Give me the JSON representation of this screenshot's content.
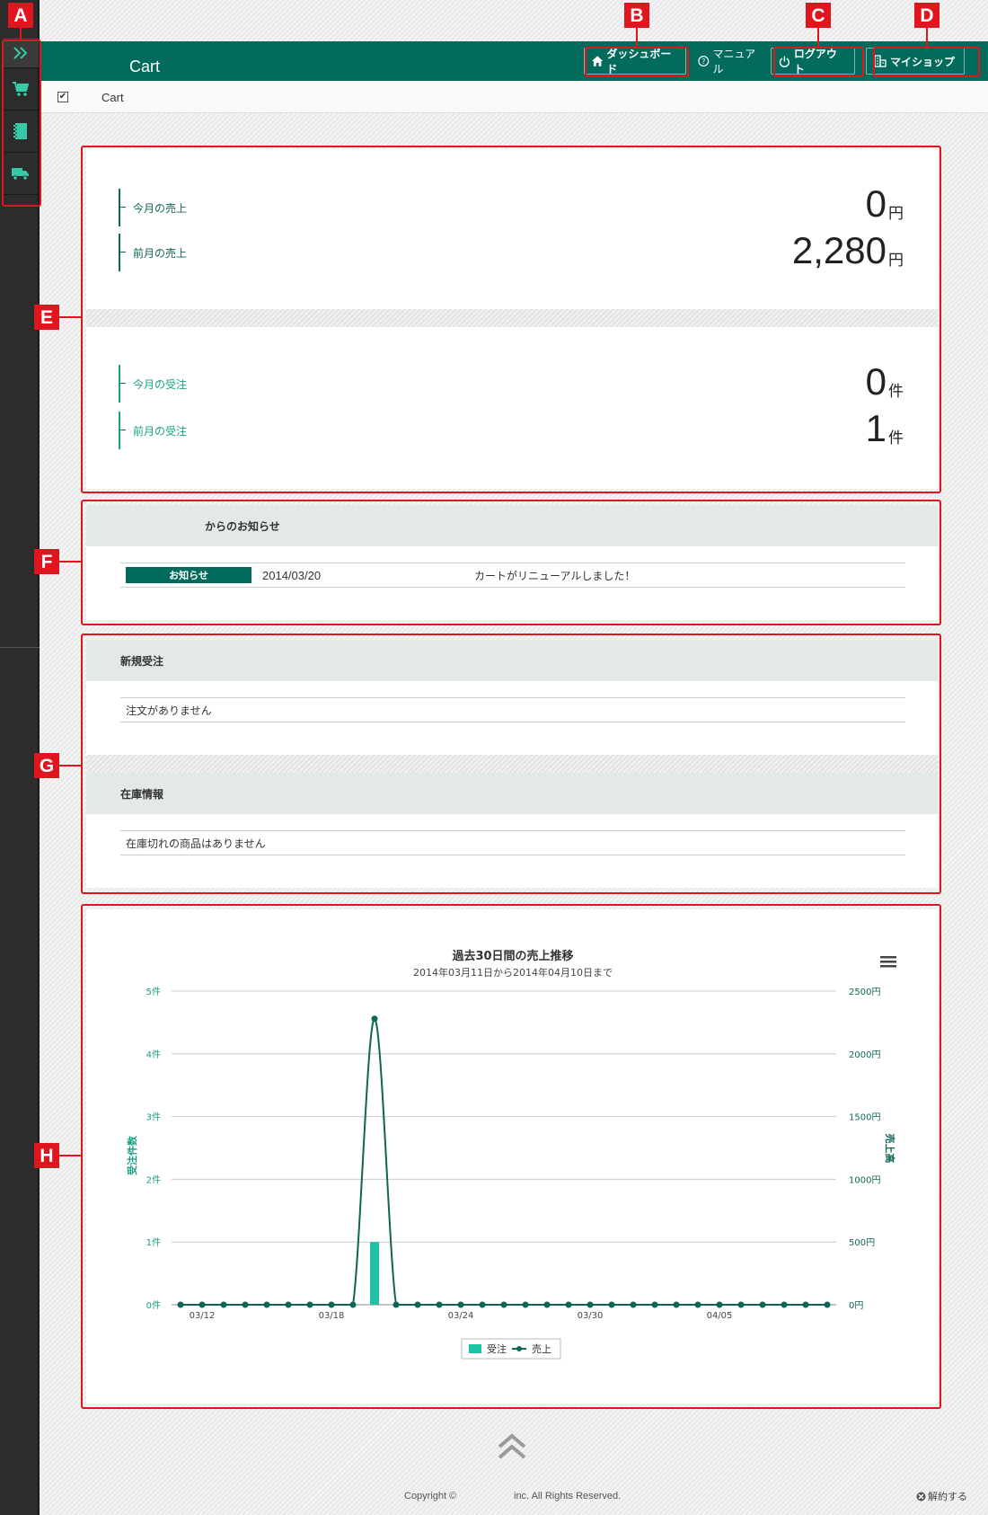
{
  "header": {
    "title": "Cart",
    "buttons": [
      {
        "label": "ダッシュボード",
        "icon": "home-icon"
      },
      {
        "label": "マニュアル",
        "icon": "help-icon"
      },
      {
        "label": "ログアウト",
        "icon": "power-icon"
      },
      {
        "label": "マイショップ",
        "icon": "shop-icon"
      }
    ]
  },
  "breadcrumb": {
    "label": "Cart"
  },
  "sidebar": {
    "items": [
      {
        "icon": "expand-icon"
      },
      {
        "icon": "cart-icon"
      },
      {
        "icon": "notebook-icon"
      },
      {
        "icon": "truck-icon"
      }
    ]
  },
  "annotations": {
    "A": "A",
    "B": "B",
    "C": "C",
    "D": "D",
    "E": "E",
    "F": "F",
    "G": "G",
    "H": "H"
  },
  "stats": {
    "sales_this_month": {
      "label": "今月の売上",
      "value": "0",
      "unit": "円"
    },
    "sales_last_month": {
      "label": "前月の売上",
      "value": "2,280",
      "unit": "円"
    },
    "orders_this_month": {
      "label": "今月の受注",
      "value": "0",
      "unit": "件"
    },
    "orders_last_month": {
      "label": "前月の受注",
      "value": "1",
      "unit": "件"
    }
  },
  "notices": {
    "title": "からのお知らせ",
    "items": [
      {
        "badge": "お知らせ",
        "date": "2014/03/20",
        "text": "カートがリニューアルしました！"
      }
    ]
  },
  "new_orders": {
    "title": "新規受注",
    "empty_text": "注文がありません"
  },
  "stock": {
    "title": "在庫情報",
    "empty_text": "在庫切れの商品はありません"
  },
  "footer": {
    "copyright": "Copyright ©",
    "rights": "inc. All Rights Reserved.",
    "cancel": "解約する"
  },
  "colors": {
    "brand": "#026b5c",
    "annotation": "#e0151e",
    "bar": "#1dc3a4"
  },
  "chart_data": {
    "type": "bar+line",
    "title": "過去30日間の売上推移",
    "subtitle": "2014年03月11日から2014年04月10日まで",
    "ylabel_left": "受注件数",
    "ylabel_right": "売上高",
    "y_left_ticks": [
      "0件",
      "1件",
      "2件",
      "3件",
      "4件",
      "5件"
    ],
    "y_right_ticks": [
      "0円",
      "500円",
      "1000円",
      "1500円",
      "2000円",
      "2500円"
    ],
    "ylim_left": [
      0,
      5
    ],
    "ylim_right": [
      0,
      2500
    ],
    "x": [
      "03/11",
      "03/12",
      "03/13",
      "03/14",
      "03/15",
      "03/16",
      "03/17",
      "03/18",
      "03/19",
      "03/20",
      "03/21",
      "03/22",
      "03/23",
      "03/24",
      "03/25",
      "03/26",
      "03/27",
      "03/28",
      "03/29",
      "03/30",
      "03/31",
      "04/01",
      "04/02",
      "04/03",
      "04/04",
      "04/05",
      "04/06",
      "04/07",
      "04/08",
      "04/09",
      "04/10"
    ],
    "x_tick_labels": [
      "03/12",
      "03/18",
      "03/24",
      "03/30",
      "04/05"
    ],
    "series": [
      {
        "name": "受注",
        "type": "bar",
        "axis": "left",
        "values": [
          0,
          0,
          0,
          0,
          0,
          0,
          0,
          0,
          0,
          1,
          0,
          0,
          0,
          0,
          0,
          0,
          0,
          0,
          0,
          0,
          0,
          0,
          0,
          0,
          0,
          0,
          0,
          0,
          0,
          0,
          0
        ]
      },
      {
        "name": "売上",
        "type": "line",
        "axis": "right",
        "values": [
          0,
          0,
          0,
          0,
          0,
          0,
          0,
          0,
          0,
          2280,
          0,
          0,
          0,
          0,
          0,
          0,
          0,
          0,
          0,
          0,
          0,
          0,
          0,
          0,
          0,
          0,
          0,
          0,
          0,
          0,
          0
        ]
      }
    ],
    "legend": "bottom-center",
    "grid": true
  }
}
